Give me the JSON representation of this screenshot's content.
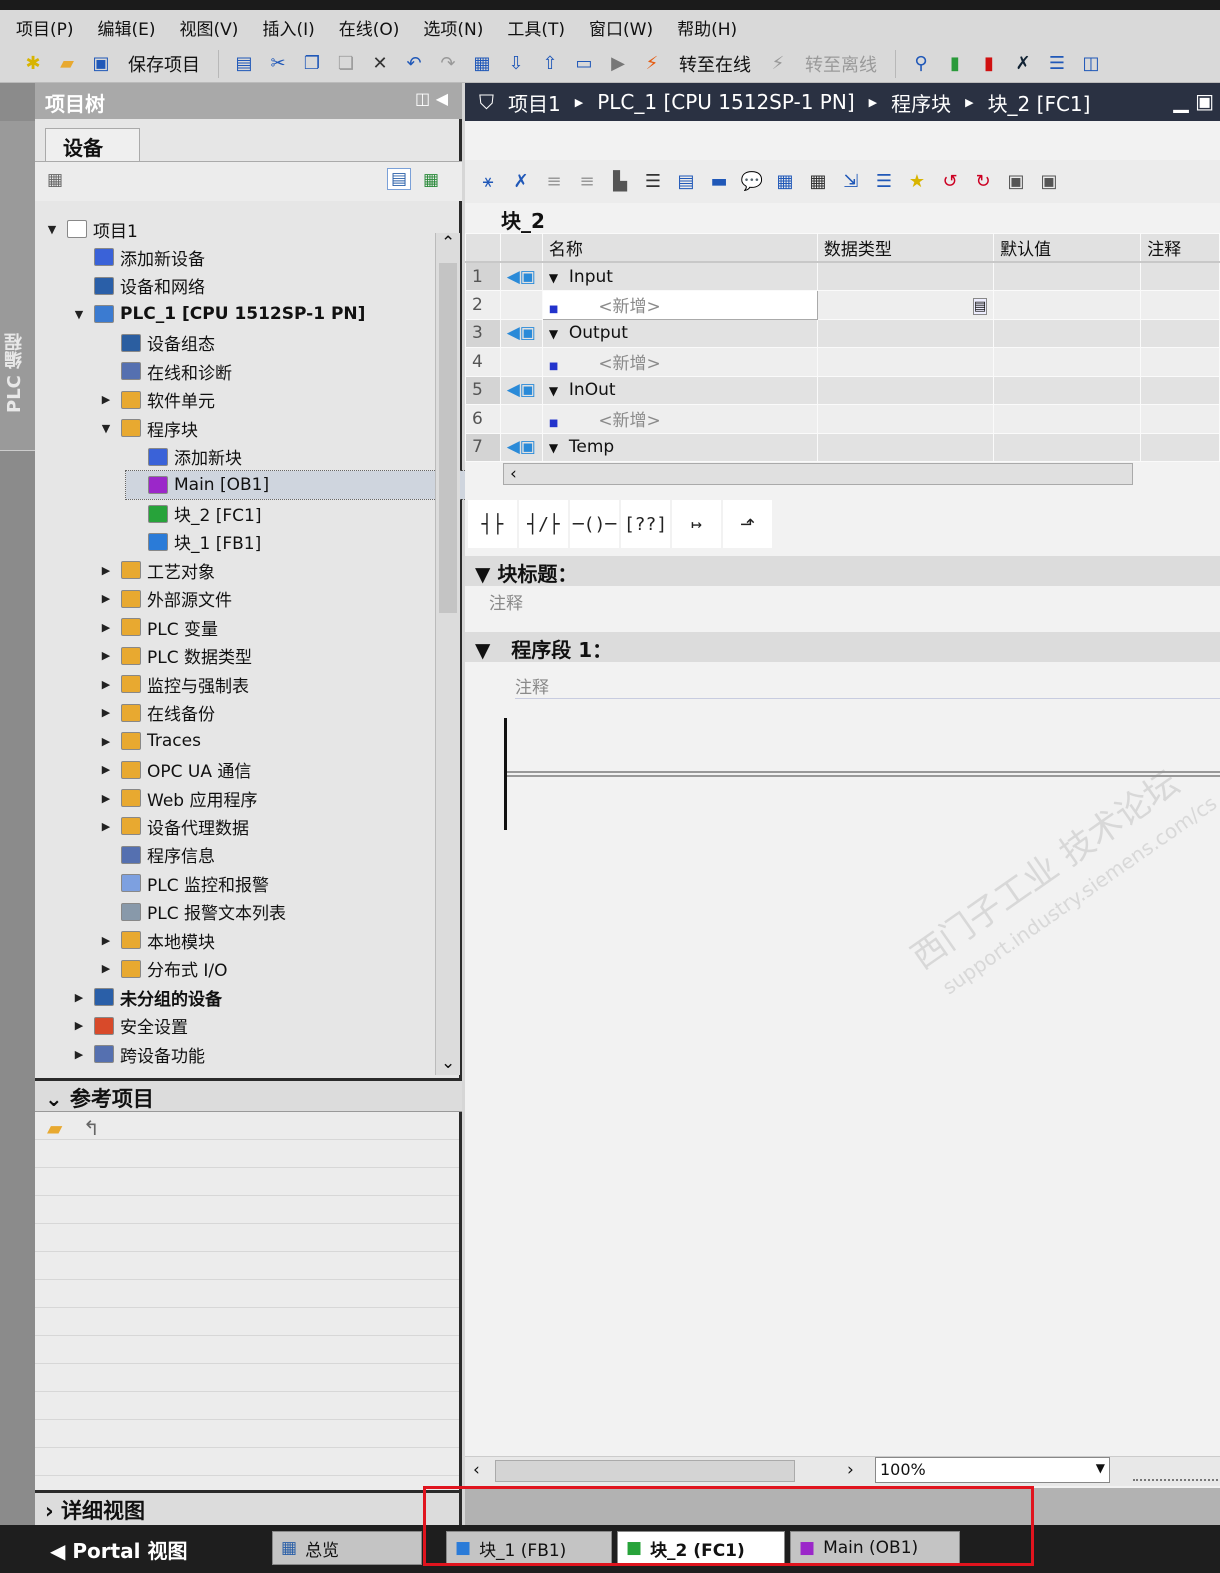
{
  "menu": [
    "项目(P)",
    "编辑(E)",
    "视图(V)",
    "插入(I)",
    "在线(O)",
    "选项(N)",
    "工具(T)",
    "窗口(W)",
    "帮助(H)"
  ],
  "toolbar": {
    "save_label": "保存项目",
    "go_online": "转至在线",
    "go_offline": "转至离线"
  },
  "side_strip": "PLC 编程",
  "tree": {
    "title": "项目树",
    "tab": "设备",
    "items": [
      {
        "label": "项目1",
        "level": 0,
        "exp": "down",
        "color": "#ffffff"
      },
      {
        "label": "添加新设备",
        "level": 1,
        "exp": "",
        "color": "#3a62d8"
      },
      {
        "label": "设备和网络",
        "level": 1,
        "exp": "",
        "color": "#2a5fa8"
      },
      {
        "label": "PLC_1 [CPU 1512SP-1 PN]",
        "level": 1,
        "exp": "down",
        "color": "#3b7bd1",
        "bold": true
      },
      {
        "label": "设备组态",
        "level": 2,
        "exp": "",
        "color": "#2b5ea0"
      },
      {
        "label": "在线和诊断",
        "level": 2,
        "exp": "",
        "color": "#5570b0"
      },
      {
        "label": "软件单元",
        "level": 2,
        "exp": "right",
        "color": "#e8a930"
      },
      {
        "label": "程序块",
        "level": 2,
        "exp": "down",
        "color": "#e8a930"
      },
      {
        "label": "添加新块",
        "level": 3,
        "exp": "",
        "color": "#3a62d8"
      },
      {
        "label": "Main [OB1]",
        "level": 3,
        "exp": "",
        "color": "#9b27c9",
        "selected": true
      },
      {
        "label": "块_2 [FC1]",
        "level": 3,
        "exp": "",
        "color": "#27a33a"
      },
      {
        "label": "块_1 [FB1]",
        "level": 3,
        "exp": "",
        "color": "#2a7bd8"
      },
      {
        "label": "工艺对象",
        "level": 2,
        "exp": "right",
        "color": "#e8a930"
      },
      {
        "label": "外部源文件",
        "level": 2,
        "exp": "right",
        "color": "#e8a930"
      },
      {
        "label": "PLC 变量",
        "level": 2,
        "exp": "right",
        "color": "#e8a930"
      },
      {
        "label": "PLC 数据类型",
        "level": 2,
        "exp": "right",
        "color": "#e8a930"
      },
      {
        "label": "监控与强制表",
        "level": 2,
        "exp": "right",
        "color": "#e8a930"
      },
      {
        "label": "在线备份",
        "level": 2,
        "exp": "right",
        "color": "#e8a930"
      },
      {
        "label": "Traces",
        "level": 2,
        "exp": "right",
        "color": "#e8a930"
      },
      {
        "label": "OPC UA 通信",
        "level": 2,
        "exp": "right",
        "color": "#e8a930"
      },
      {
        "label": "Web 应用程序",
        "level": 2,
        "exp": "right",
        "color": "#e8a930"
      },
      {
        "label": "设备代理数据",
        "level": 2,
        "exp": "right",
        "color": "#e8a930"
      },
      {
        "label": "程序信息",
        "level": 2,
        "exp": "",
        "color": "#5570b0"
      },
      {
        "label": "PLC 监控和报警",
        "level": 2,
        "exp": "",
        "color": "#7da0e0"
      },
      {
        "label": "PLC 报警文本列表",
        "level": 2,
        "exp": "",
        "color": "#8899aa"
      },
      {
        "label": "本地模块",
        "level": 2,
        "exp": "right",
        "color": "#e8a930"
      },
      {
        "label": "分布式 I/O",
        "level": 2,
        "exp": "right",
        "color": "#e8a930"
      },
      {
        "label": "未分组的设备",
        "level": 1,
        "exp": "right",
        "color": "#2a5fa8",
        "bold": true
      },
      {
        "label": "安全设置",
        "level": 1,
        "exp": "right",
        "color": "#d84a2a"
      },
      {
        "label": "跨设备功能",
        "level": 1,
        "exp": "right",
        "color": "#5570b0"
      }
    ]
  },
  "reference": {
    "title": "参考项目"
  },
  "details": {
    "title": "详细视图"
  },
  "breadcrumb": [
    "项目1",
    "PLC_1 [CPU 1512SP-1 PN]",
    "程序块",
    "块_2 [FC1]"
  ],
  "editor": {
    "block_name": "块_2",
    "columns": [
      "名称",
      "数据类型",
      "默认值",
      "注释"
    ],
    "rows": [
      {
        "n": "1",
        "name": "Input",
        "section": true
      },
      {
        "n": "2",
        "name": "<新增>",
        "section": false
      },
      {
        "n": "3",
        "name": "Output",
        "section": true
      },
      {
        "n": "4",
        "name": "<新增>",
        "section": false
      },
      {
        "n": "5",
        "name": "InOut",
        "section": true
      },
      {
        "n": "6",
        "name": "<新增>",
        "section": false
      },
      {
        "n": "7",
        "name": "Temp",
        "section": true
      }
    ],
    "block_title": "块标题：",
    "block_comment": "注释",
    "network_title": "程序段 1：",
    "network_comment": "注释",
    "zoom": "100%"
  },
  "watermark": {
    "line1": "西门子工业 技术论坛",
    "line2": "support.industry.siemens.com/cs"
  },
  "taskbar": {
    "portal": "Portal 视图",
    "tabs": [
      {
        "label": "总览",
        "color": "#2a5fa8",
        "active": false
      },
      {
        "label": "块_1 (FB1)",
        "color": "#2a7bd8",
        "active": false
      },
      {
        "label": "块_2 (FC1)",
        "color": "#27a33a",
        "active": true
      },
      {
        "label": "Main (OB1)",
        "color": "#9b27c9",
        "active": false
      }
    ]
  },
  "highlight_color": "#e0141e"
}
